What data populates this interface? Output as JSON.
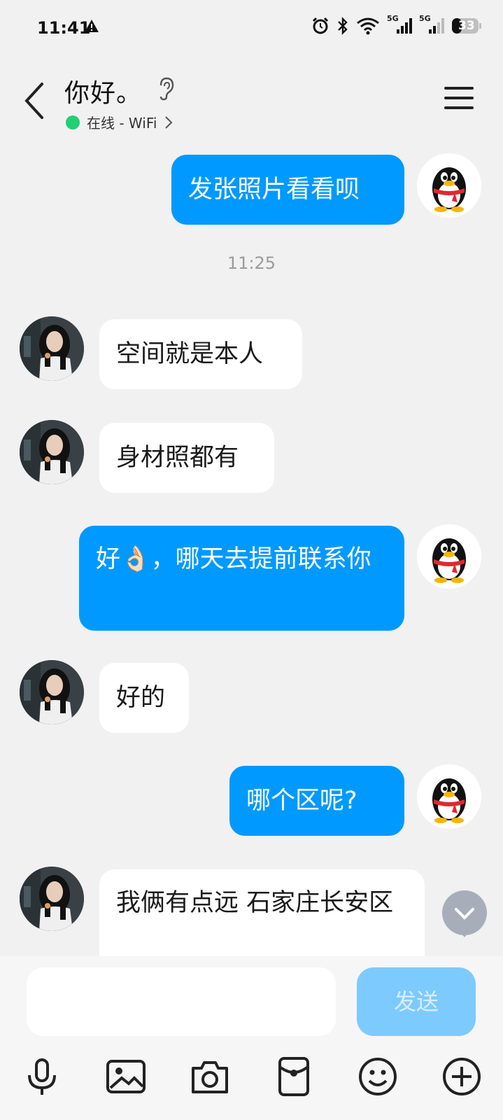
{
  "status_bar": {
    "time": "11:41",
    "battery": "33",
    "network_1": "5G",
    "network_2": "5G",
    "icons": [
      "warning-icon",
      "alarm-icon",
      "bluetooth-icon",
      "wifi-icon",
      "signal-icon",
      "signal-icon",
      "battery-icon"
    ]
  },
  "header": {
    "title": "你好。",
    "status_text": "在线 - WiFi",
    "online_color": "#22cf72"
  },
  "messages": [
    {
      "side": "me",
      "text": "发张照片看看呗"
    },
    {
      "side": "them",
      "text": "空间就是本人"
    },
    {
      "side": "them",
      "text": "身材照都有"
    },
    {
      "side": "me",
      "text": "好👌🏻，哪天去提前联系你"
    },
    {
      "side": "them",
      "text": "好的"
    },
    {
      "side": "me",
      "text": "哪个区呢?"
    },
    {
      "side": "them",
      "text": "我俩有点远   石家庄长安区"
    }
  ],
  "timestamp": "11:25",
  "input": {
    "placeholder": "",
    "send_label": "发送"
  },
  "colors": {
    "accent": "#0099ff",
    "send_disabled": "#7dcaff",
    "background": "#f1f1f1"
  },
  "toolbar": [
    "mic-icon",
    "image-icon",
    "camera-icon",
    "red-packet-icon",
    "emoji-icon",
    "plus-icon"
  ]
}
